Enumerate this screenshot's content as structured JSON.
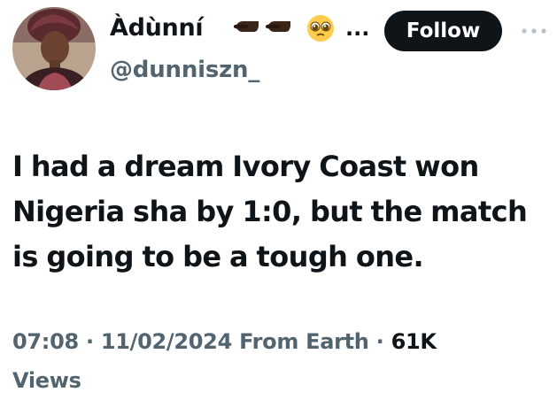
{
  "author": {
    "display_name": "Àdùnní",
    "name_emojis": [
      "backhand-index-pointing-left-icon",
      "backhand-index-pointing-left-icon",
      "pleading-face-icon"
    ],
    "name_truncation": "...",
    "handle": "@dunniszn_"
  },
  "follow_button": {
    "label": "Follow"
  },
  "more_icon": "more-horizontal-icon",
  "tweet": {
    "lines": [
      "I had a dream Ivory Coast won",
      "Nigeria sha by 1:0, but the match",
      "is going to be a tough one."
    ]
  },
  "meta": {
    "time": "07:08",
    "separator": "·",
    "date": "11/02/2024",
    "source": "From Earth",
    "views_count": "61K",
    "views_label": "Views"
  },
  "colors": {
    "text_primary": "#0f1419",
    "text_secondary": "#536471",
    "follow_bg": "#0f1419",
    "follow_text": "#ffffff"
  }
}
